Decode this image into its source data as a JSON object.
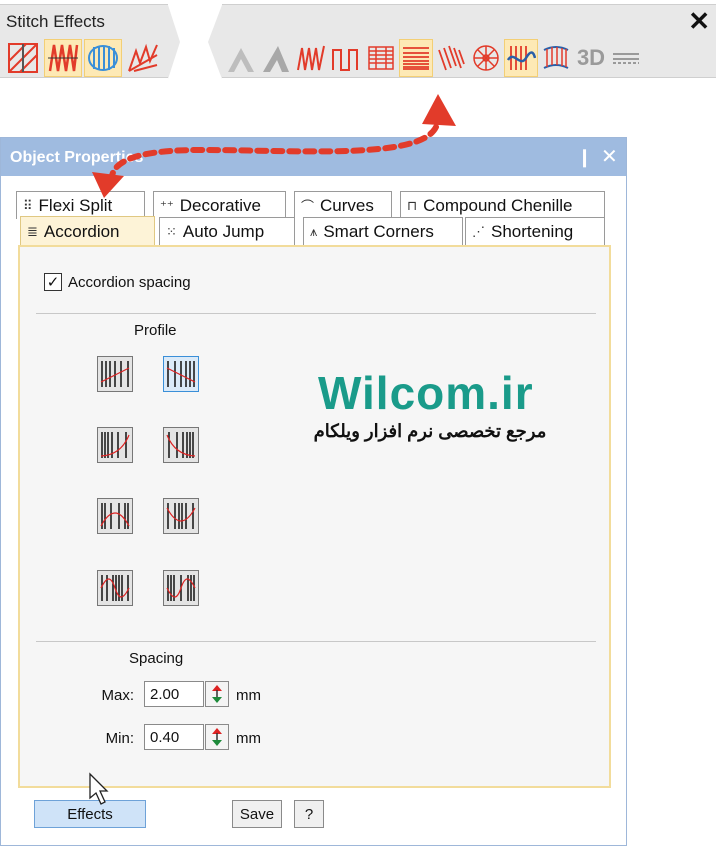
{
  "toolbar": {
    "title": "Stitch Effects",
    "close_glyph": "✕",
    "left_icons": [
      "cross-stitch-icon",
      "zigzag-fill-icon",
      "wave-fill-icon",
      "jagged-edge-icon"
    ],
    "right_icons": [
      "sharp-corner-a-icon",
      "sharp-corner-b-icon",
      "zigzag-edge-icon",
      "square-wave-icon",
      "accordion-fill-icon",
      "accordion-spacing-icon",
      "diagonal-pattern-icon",
      "radial-fill-icon",
      "wave-effect-icon",
      "curved-fill-icon",
      "3d-effect-icon",
      "line-settings-icon"
    ],
    "three_d_label": "3D",
    "accent": "#e23b2a"
  },
  "panel": {
    "title": "Object Properties",
    "pin_glyph": "📌",
    "close_glyph": "✕",
    "tabs_row1": [
      {
        "label": "Flexi Split",
        "icon": "flexi-split-icon",
        "glyph": "⠿"
      },
      {
        "label": "Decorative",
        "icon": "decorative-icon",
        "glyph": "⁺⁺"
      },
      {
        "label": "Curves",
        "icon": "curves-icon",
        "glyph": "⌒"
      },
      {
        "label": "Compound Chenille",
        "icon": "compound-chenille-icon",
        "glyph": "⊓"
      }
    ],
    "tabs_row2": [
      {
        "label": "Accordion",
        "icon": "accordion-icon",
        "glyph": "≣"
      },
      {
        "label": "Auto Jump",
        "icon": "auto-jump-icon",
        "glyph": "⁙"
      },
      {
        "label": "Smart Corners",
        "icon": "smart-corners-icon",
        "glyph": "⩚"
      },
      {
        "label": "Shortening",
        "icon": "shortening-icon",
        "glyph": "⋰"
      }
    ],
    "accordion_spacing_label": "Accordion spacing",
    "accordion_spacing_checked": true,
    "profile_label": "Profile",
    "spacing_label": "Spacing",
    "max_label": "Max:",
    "max_value": "2.00",
    "min_label": "Min:",
    "min_value": "0.40",
    "unit": "mm",
    "effects_button": "Effects",
    "save_button": "Save",
    "help_button": "?"
  },
  "watermark": {
    "title": "Wilcom.ir",
    "subtitle": "مرجع تخصصی نرم افزار ویلکام"
  },
  "colors": {
    "title_bar": "#9fbbe0",
    "active_tab": "#fdf3d7",
    "watermark_green": "#1a9b8a",
    "arrow_red": "#e23b2a"
  }
}
